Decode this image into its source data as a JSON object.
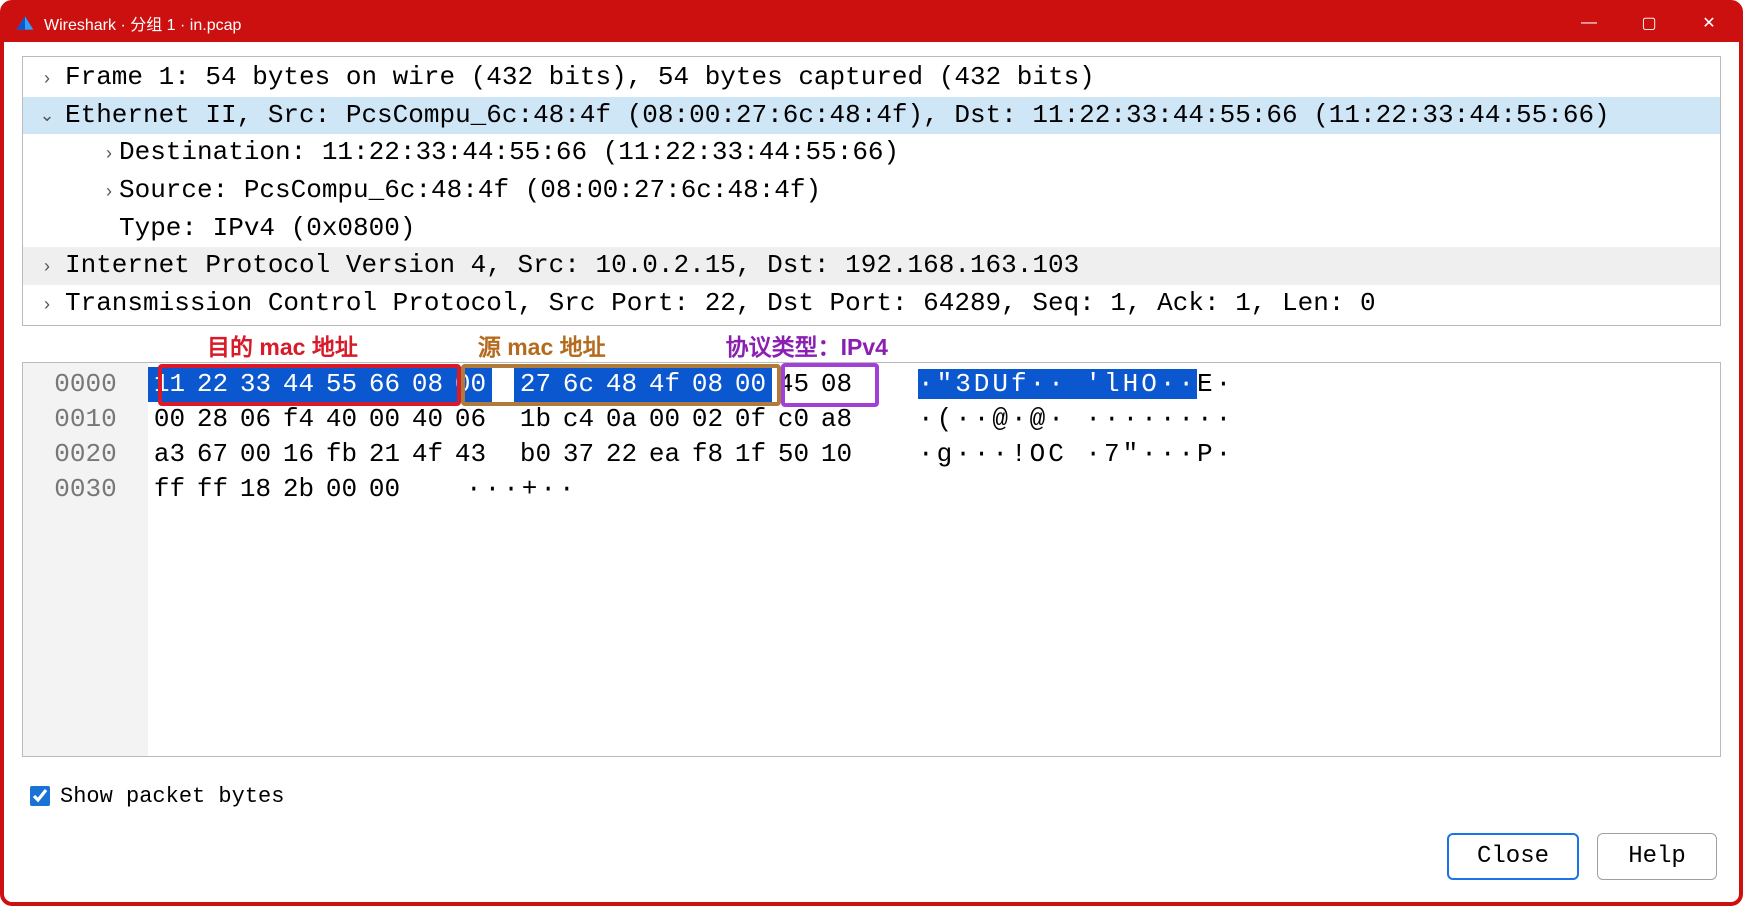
{
  "window": {
    "title": "Wireshark · 分组 1 · in.pcap",
    "buttons": {
      "minimize": "—",
      "maximize": "▢",
      "close": "✕"
    }
  },
  "tree": {
    "frame": "Frame 1: 54 bytes on wire (432 bits), 54 bytes captured (432 bits)",
    "eth": "Ethernet II, Src: PcsCompu_6c:48:4f (08:00:27:6c:48:4f), Dst: 11:22:33:44:55:66 (11:22:33:44:55:66)",
    "eth_dst": "Destination: 11:22:33:44:55:66 (11:22:33:44:55:66)",
    "eth_src": "Source: PcsCompu_6c:48:4f (08:00:27:6c:48:4f)",
    "eth_type": "Type: IPv4 (0x0800)",
    "ip": "Internet Protocol Version 4, Src: 10.0.2.15, Dst: 192.168.163.103",
    "tcp": "Transmission Control Protocol, Src Port: 22, Dst Port: 64289, Seq: 1, Ack: 1, Len: 0"
  },
  "annotations": {
    "dst": "目的 mac 地址",
    "src": "源 mac 地址",
    "type": "协议类型：IPv4"
  },
  "hex": {
    "offsets": [
      "0000",
      "0010",
      "0020",
      "0030"
    ],
    "bytes": [
      [
        "11",
        "22",
        "33",
        "44",
        "55",
        "66",
        "08",
        "00",
        "27",
        "6c",
        "48",
        "4f",
        "08",
        "00",
        "45",
        "08"
      ],
      [
        "00",
        "28",
        "06",
        "f4",
        "40",
        "00",
        "40",
        "06",
        "1b",
        "c4",
        "0a",
        "00",
        "02",
        "0f",
        "c0",
        "a8"
      ],
      [
        "a3",
        "67",
        "00",
        "16",
        "fb",
        "21",
        "4f",
        "43",
        "b0",
        "37",
        "22",
        "ea",
        "f8",
        "1f",
        "50",
        "10"
      ],
      [
        "ff",
        "ff",
        "18",
        "2b",
        "00",
        "00"
      ]
    ],
    "ascii": [
      {
        "sel": "·\"3DUf·· 'lHO··",
        "rest": "E·"
      },
      {
        "sel": "",
        "rest": "·(··@·@· ········"
      },
      {
        "sel": "",
        "rest": "·g···!OC ·7\"···P·"
      },
      {
        "sel": "",
        "rest": "···+··"
      }
    ],
    "selected_byte_count": 14
  },
  "bottom": {
    "show_bytes": "Show packet bytes",
    "close": "Close",
    "help": "Help"
  }
}
